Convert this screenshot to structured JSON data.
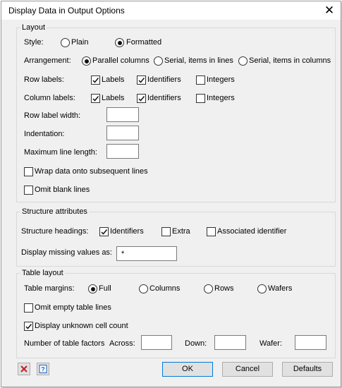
{
  "window": {
    "title": "Display Data in Output Options",
    "close_glyph": "✕"
  },
  "layout": {
    "group_title": "Layout",
    "style": {
      "label": "Style:",
      "options": [
        "Plain",
        "Formatted"
      ],
      "selected": "Formatted"
    },
    "arrangement": {
      "label": "Arrangement:",
      "options": [
        "Parallel columns",
        "Serial, items in lines",
        "Serial, items in columns"
      ],
      "selected": "Parallel columns"
    },
    "row_labels": {
      "label": "Row labels:",
      "items": [
        {
          "label": "Labels",
          "checked": true
        },
        {
          "label": "Identifiers",
          "checked": true
        },
        {
          "label": "Integers",
          "checked": false
        }
      ]
    },
    "column_labels": {
      "label": "Column labels:",
      "items": [
        {
          "label": "Labels",
          "checked": true
        },
        {
          "label": "Identifiers",
          "checked": true
        },
        {
          "label": "Integers",
          "checked": false
        }
      ]
    },
    "row_label_width": {
      "label": "Row label width:",
      "value": ""
    },
    "indentation": {
      "label": "Indentation:",
      "value": ""
    },
    "max_line_length": {
      "label": "Maximum line length:",
      "value": ""
    },
    "wrap": {
      "label": "Wrap data onto subsequent lines",
      "checked": false
    },
    "omit_blank": {
      "label": "Omit blank lines",
      "checked": false
    }
  },
  "structure": {
    "group_title": "Structure attributes",
    "headings_label": "Structure headings:",
    "headings": [
      {
        "label": "Identifiers",
        "checked": true
      },
      {
        "label": "Extra",
        "checked": false
      },
      {
        "label": "Associated identifier",
        "checked": false
      }
    ],
    "missing_label": "Display missing values as:",
    "missing_value": "*"
  },
  "table": {
    "group_title": "Table layout",
    "margins_label": "Table margins:",
    "margins": [
      "Full",
      "Columns",
      "Rows",
      "Wafers"
    ],
    "margins_selected": "Full",
    "omit_empty": {
      "label": "Omit empty table lines",
      "checked": false
    },
    "unknown_cell": {
      "label": "Display unknown cell count",
      "checked": true
    },
    "factors_label": "Number of table factors",
    "across_label": "Across:",
    "across_value": "",
    "down_label": "Down:",
    "down_value": "",
    "wafer_label": "Wafer:",
    "wafer_value": ""
  },
  "footer": {
    "clear_icon": "clear-icon",
    "help_icon": "help-icon",
    "ok": "OK",
    "cancel": "Cancel",
    "defaults": "Defaults"
  },
  "colors": {
    "accent": "#0078d7",
    "clear_red": "#c0202a",
    "help_blue": "#1a5fb4"
  }
}
